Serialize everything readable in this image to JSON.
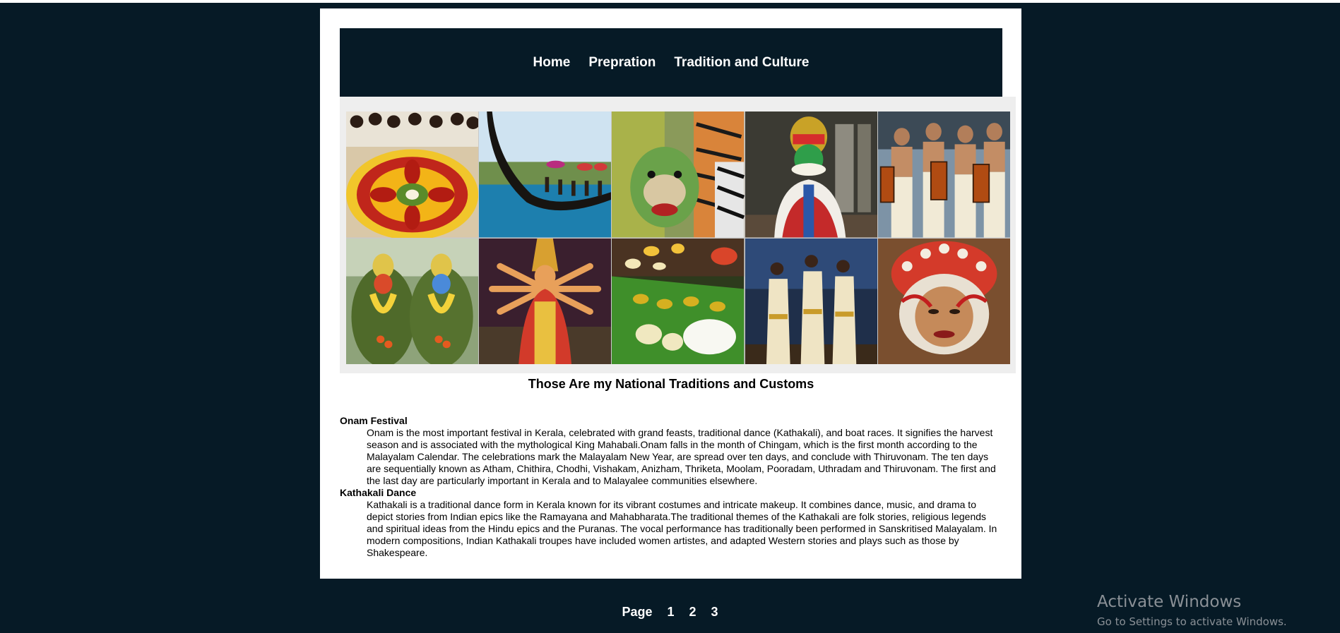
{
  "nav": {
    "items": [
      {
        "label": "Home"
      },
      {
        "label": "Prepration"
      },
      {
        "label": "Tradition and Culture"
      }
    ]
  },
  "gallery": {
    "images": [
      {
        "name": "onam-pookalam-image"
      },
      {
        "name": "snake-boat-race-image"
      },
      {
        "name": "pulikali-tiger-dance-image"
      },
      {
        "name": "kathakali-performer-image"
      },
      {
        "name": "chenda-drummers-image"
      },
      {
        "name": "theyyam-green-costume-image"
      },
      {
        "name": "many-armed-deity-image"
      },
      {
        "name": "onam-sadhya-feast-image"
      },
      {
        "name": "thiruvathira-dance-image"
      },
      {
        "name": "theyyam-face-image"
      }
    ]
  },
  "main": {
    "heading": "Those Are my National Traditions and Customs",
    "sections": [
      {
        "term": "Onam Festival",
        "text": "Onam is the most important festival in Kerala, celebrated with grand feasts, traditional dance (Kathakali), and boat races. It signifies the harvest season and is associated with the mythological King Mahabali.Onam falls in the month of Chingam, which is the first month according to the Malayalam Calendar. The celebrations mark the Malayalam New Year, are spread over ten days, and conclude with Thiruvonam. The ten days are sequentially known as Atham, Chithira, Chodhi, Vishakam, Anizham, Thriketa, Moolam, Pooradam, Uthradam and Thiruvonam. The first and the last day are particularly important in Kerala and to Malayalee communities elsewhere."
      },
      {
        "term": "Kathakali Dance",
        "text": "Kathakali is a traditional dance form in Kerala known for its vibrant costumes and intricate makeup. It combines dance, music, and drama to depict stories from Indian epics like the Ramayana and Mahabharata.The traditional themes of the Kathakali are folk stories, religious legends and spiritual ideas from the Hindu epics and the Puranas. The vocal performance has traditionally been performed in Sanskritised Malayalam. In modern compositions, Indian Kathakali troupes have included women artistes, and adapted Western stories and plays such as those by Shakespeare."
      }
    ]
  },
  "pager": {
    "label": "Page",
    "pages": [
      "1",
      "2",
      "3"
    ]
  },
  "watermark": {
    "title": "Activate Windows",
    "subtitle": "Go to Settings to activate Windows."
  },
  "colors": {
    "page_bg": "#061a26",
    "card_bg": "#ffffff",
    "gallery_bg": "#eeeeee"
  }
}
